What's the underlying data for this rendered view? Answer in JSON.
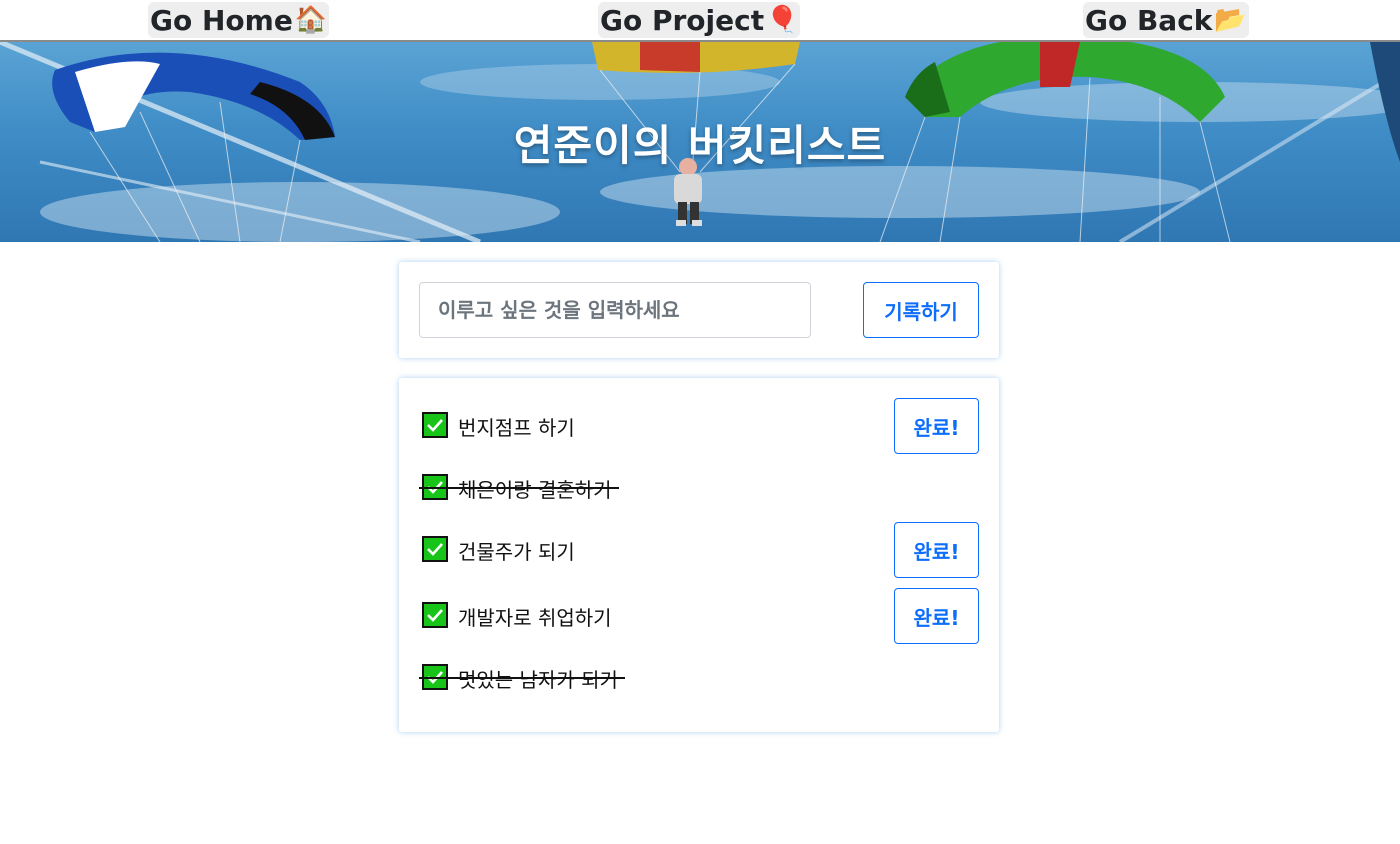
{
  "nav": {
    "home": {
      "label": "Go Home",
      "emoji": "🏠"
    },
    "project": {
      "label": "Go Project",
      "emoji": "🎈"
    },
    "back": {
      "label": "Go Back",
      "emoji": "📂"
    }
  },
  "banner": {
    "title": "연준이의 버킷리스트"
  },
  "form": {
    "placeholder": "이루고 싶은 것을 입력하세요",
    "submit_label": "기록하기"
  },
  "bucket_list": {
    "items": [
      {
        "label": "번지점프 하기",
        "done": false,
        "button_label": "완료!"
      },
      {
        "label": "채은이랑 결혼하기",
        "done": true
      },
      {
        "label": "건물주가 되기",
        "done": false,
        "button_label": "완료!"
      },
      {
        "label": "개발자로 취업하기",
        "done": false,
        "button_label": "완료!"
      },
      {
        "label": "멋있는 남자가 되기",
        "done": true
      }
    ]
  },
  "colors": {
    "accent": "#0d6efd",
    "check": "#18c418",
    "sky": "#3f8cc6"
  }
}
